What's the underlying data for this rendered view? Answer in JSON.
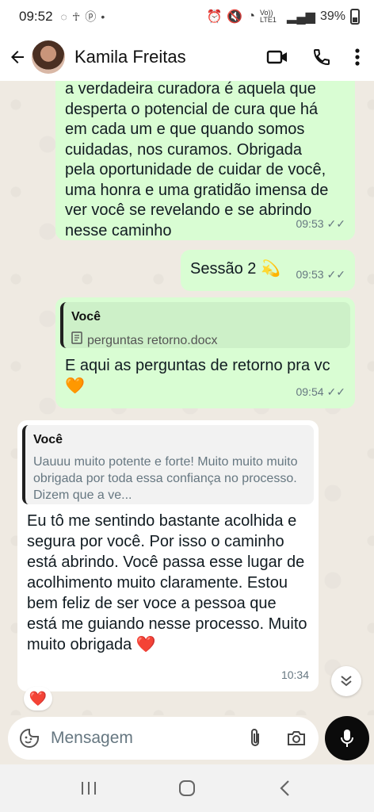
{
  "status_bar": {
    "time": "09:52",
    "network": "Vo)) LTE1",
    "battery": "39%"
  },
  "header": {
    "contact_name": "Kamila Freitas"
  },
  "messages": [
    {
      "direction": "outgoing",
      "text": "a verdadeira curadora é aquela que desperta o potencial de cura que há em cada um e que quando somos cuidadas, nos curamos. Obrigada pela oportunidade de cuidar de você, uma honra e uma gratidão imensa de ver você se revelando e se abrindo nesse caminho",
      "time": "09:53"
    },
    {
      "direction": "outgoing",
      "text": "Sessão 2 💫",
      "time": "09:53"
    },
    {
      "direction": "outgoing",
      "quote": {
        "author": "Você",
        "document": "perguntas retorno.docx"
      },
      "text": "E aqui as perguntas de retorno pra vc 🧡",
      "time": "09:54"
    },
    {
      "direction": "incoming",
      "quote": {
        "author": "Você",
        "text": "Uauuu muito potente e forte! Muito muito muito obrigada por toda essa confiança no processo. Dizem que a ve..."
      },
      "text": "Eu tô me sentindo bastante acolhida e segura por você. Por isso o caminho está abrindo. Você passa esse lugar de acolhimento muito claramente. Estou bem feliz de ser voce a pessoa que está me guiando nesse processo. Muito muito obrigada ❤️",
      "time": "10:34",
      "reaction": "❤️"
    }
  ],
  "composer": {
    "placeholder": "Mensagem"
  },
  "colors": {
    "outgoing_bubble": "#d9fdd3",
    "incoming_bubble": "#ffffff",
    "read_ticks": "#53bdeb",
    "background": "#efeae2"
  },
  "icons": [
    "back-arrow-icon",
    "video-call-icon",
    "phone-icon",
    "more-options-icon",
    "document-icon",
    "double-check-icon",
    "scroll-down-icon",
    "emoji-sticker-icon",
    "paperclip-icon",
    "camera-icon",
    "microphone-icon",
    "recent-apps-icon",
    "home-icon",
    "nav-back-icon"
  ]
}
